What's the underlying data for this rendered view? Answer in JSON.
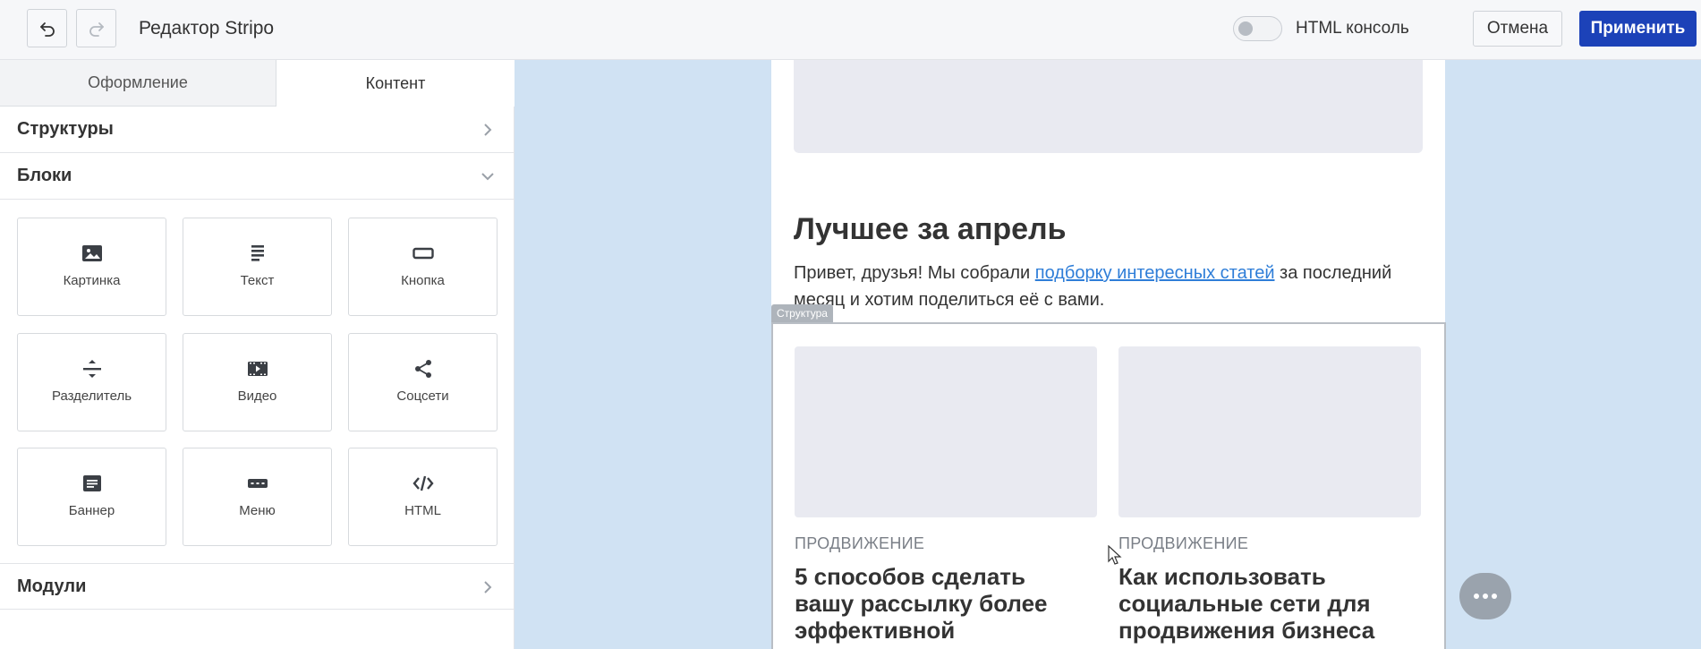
{
  "header": {
    "title": "Редактор Stripo",
    "html_console_label": "HTML консоль",
    "cancel_label": "Отмена",
    "apply_label": "Применить",
    "accent_color": "#1c42b8"
  },
  "sidebar": {
    "tabs": [
      {
        "label": "Оформление",
        "active": false
      },
      {
        "label": "Контент",
        "active": true
      }
    ],
    "sections": {
      "structures": "Структуры",
      "blocks": "Блоки",
      "modules": "Модули"
    },
    "blocks": [
      {
        "label": "Картинка",
        "icon": "image-icon"
      },
      {
        "label": "Текст",
        "icon": "text-icon"
      },
      {
        "label": "Кнопка",
        "icon": "button-icon"
      },
      {
        "label": "Разделитель",
        "icon": "divider-icon"
      },
      {
        "label": "Видео",
        "icon": "video-icon"
      },
      {
        "label": "Соцсети",
        "icon": "share-icon"
      },
      {
        "label": "Баннер",
        "icon": "banner-icon"
      },
      {
        "label": "Меню",
        "icon": "menu-icon"
      },
      {
        "label": "HTML",
        "icon": "code-icon"
      }
    ]
  },
  "canvas": {
    "heading": "Лучшее за апрель",
    "paragraph_before": "Привет, друзья! Мы собрали ",
    "paragraph_link": "подборку интересных статей",
    "paragraph_after": " за последний месяц и хотим поделиться её с вами.",
    "structure_label": "Структура",
    "articles": [
      {
        "category": "ПРОДВИЖЕНИЕ",
        "title": "5 способов сделать вашу рассылку более эффективной"
      },
      {
        "category": "ПРОДВИЖЕНИЕ",
        "title": "Как использовать социальные сети для продвижения бизнеса"
      }
    ],
    "background_color": "#d0e2f3"
  }
}
